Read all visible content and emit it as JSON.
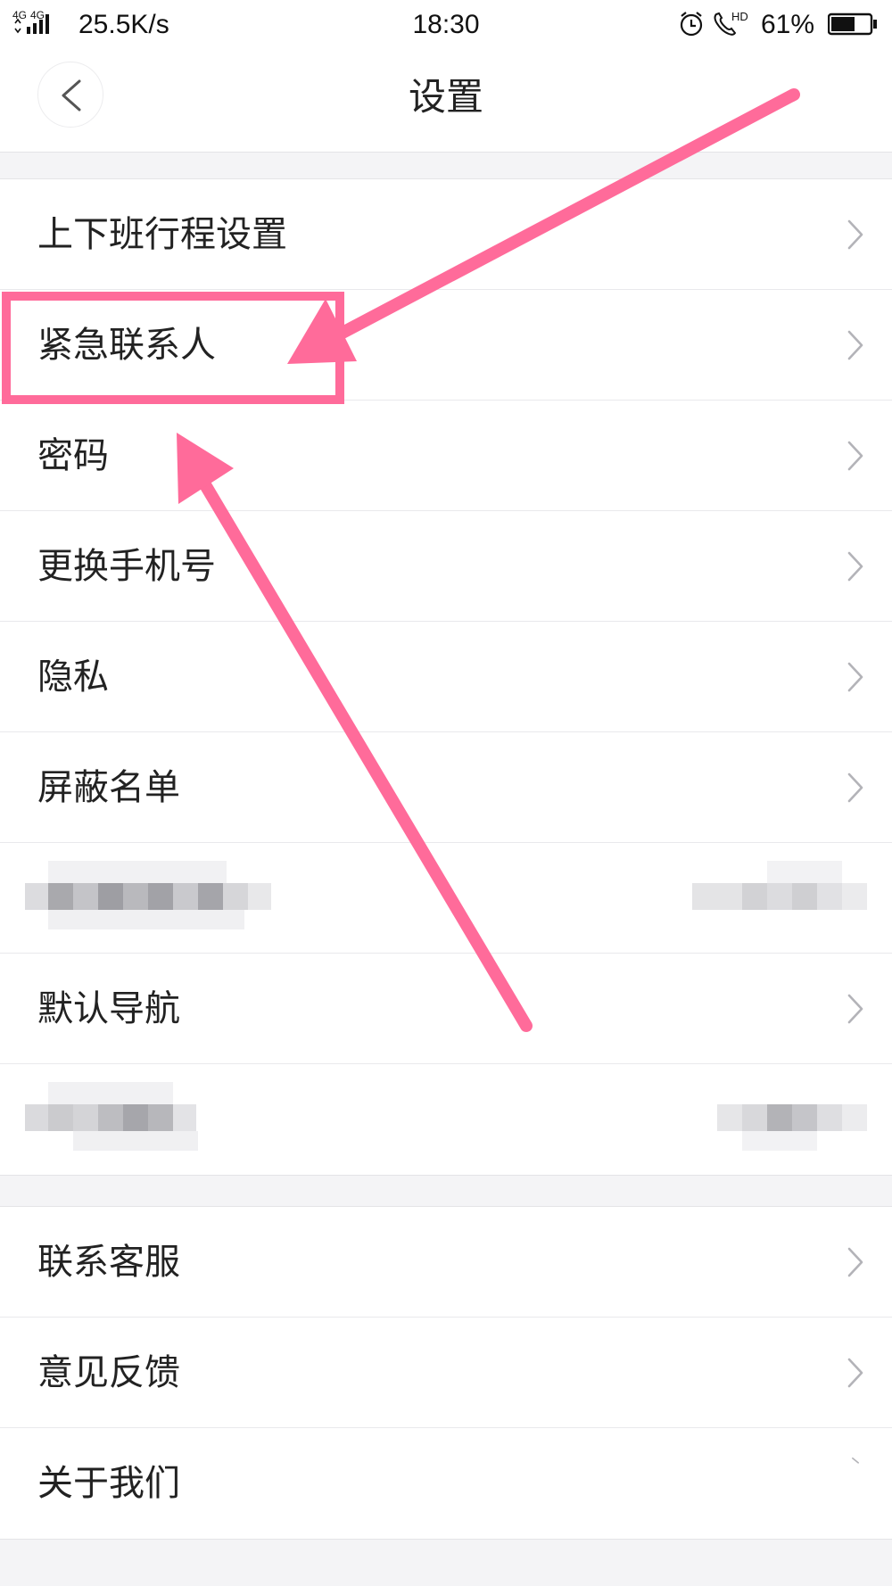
{
  "status_bar": {
    "network": "4G 4G",
    "speed": "25.5K/s",
    "time": "18:30",
    "battery": "61%",
    "battery_level": 0.61,
    "icons": [
      "signal-icon",
      "alarm-icon",
      "hd-call-icon",
      "battery-icon"
    ]
  },
  "header": {
    "title": "设置",
    "back_icon": "chevron-left-icon"
  },
  "settings": {
    "group1": [
      {
        "label": "上下班行程设置"
      },
      {
        "label": "紧急联系人"
      },
      {
        "label": "密码"
      },
      {
        "label": "更换手机号"
      },
      {
        "label": "隐私"
      },
      {
        "label": "屏蔽名单"
      },
      {
        "label": ""
      },
      {
        "label": "默认导航"
      },
      {
        "label": ""
      }
    ],
    "group2": [
      {
        "label": "联系客服"
      },
      {
        "label": "意见反馈"
      },
      {
        "label": "关于我们"
      }
    ]
  },
  "colors": {
    "annotation": "#ff6b9a",
    "background": "#f4f4f6",
    "chevron": "#b3b3b8"
  }
}
